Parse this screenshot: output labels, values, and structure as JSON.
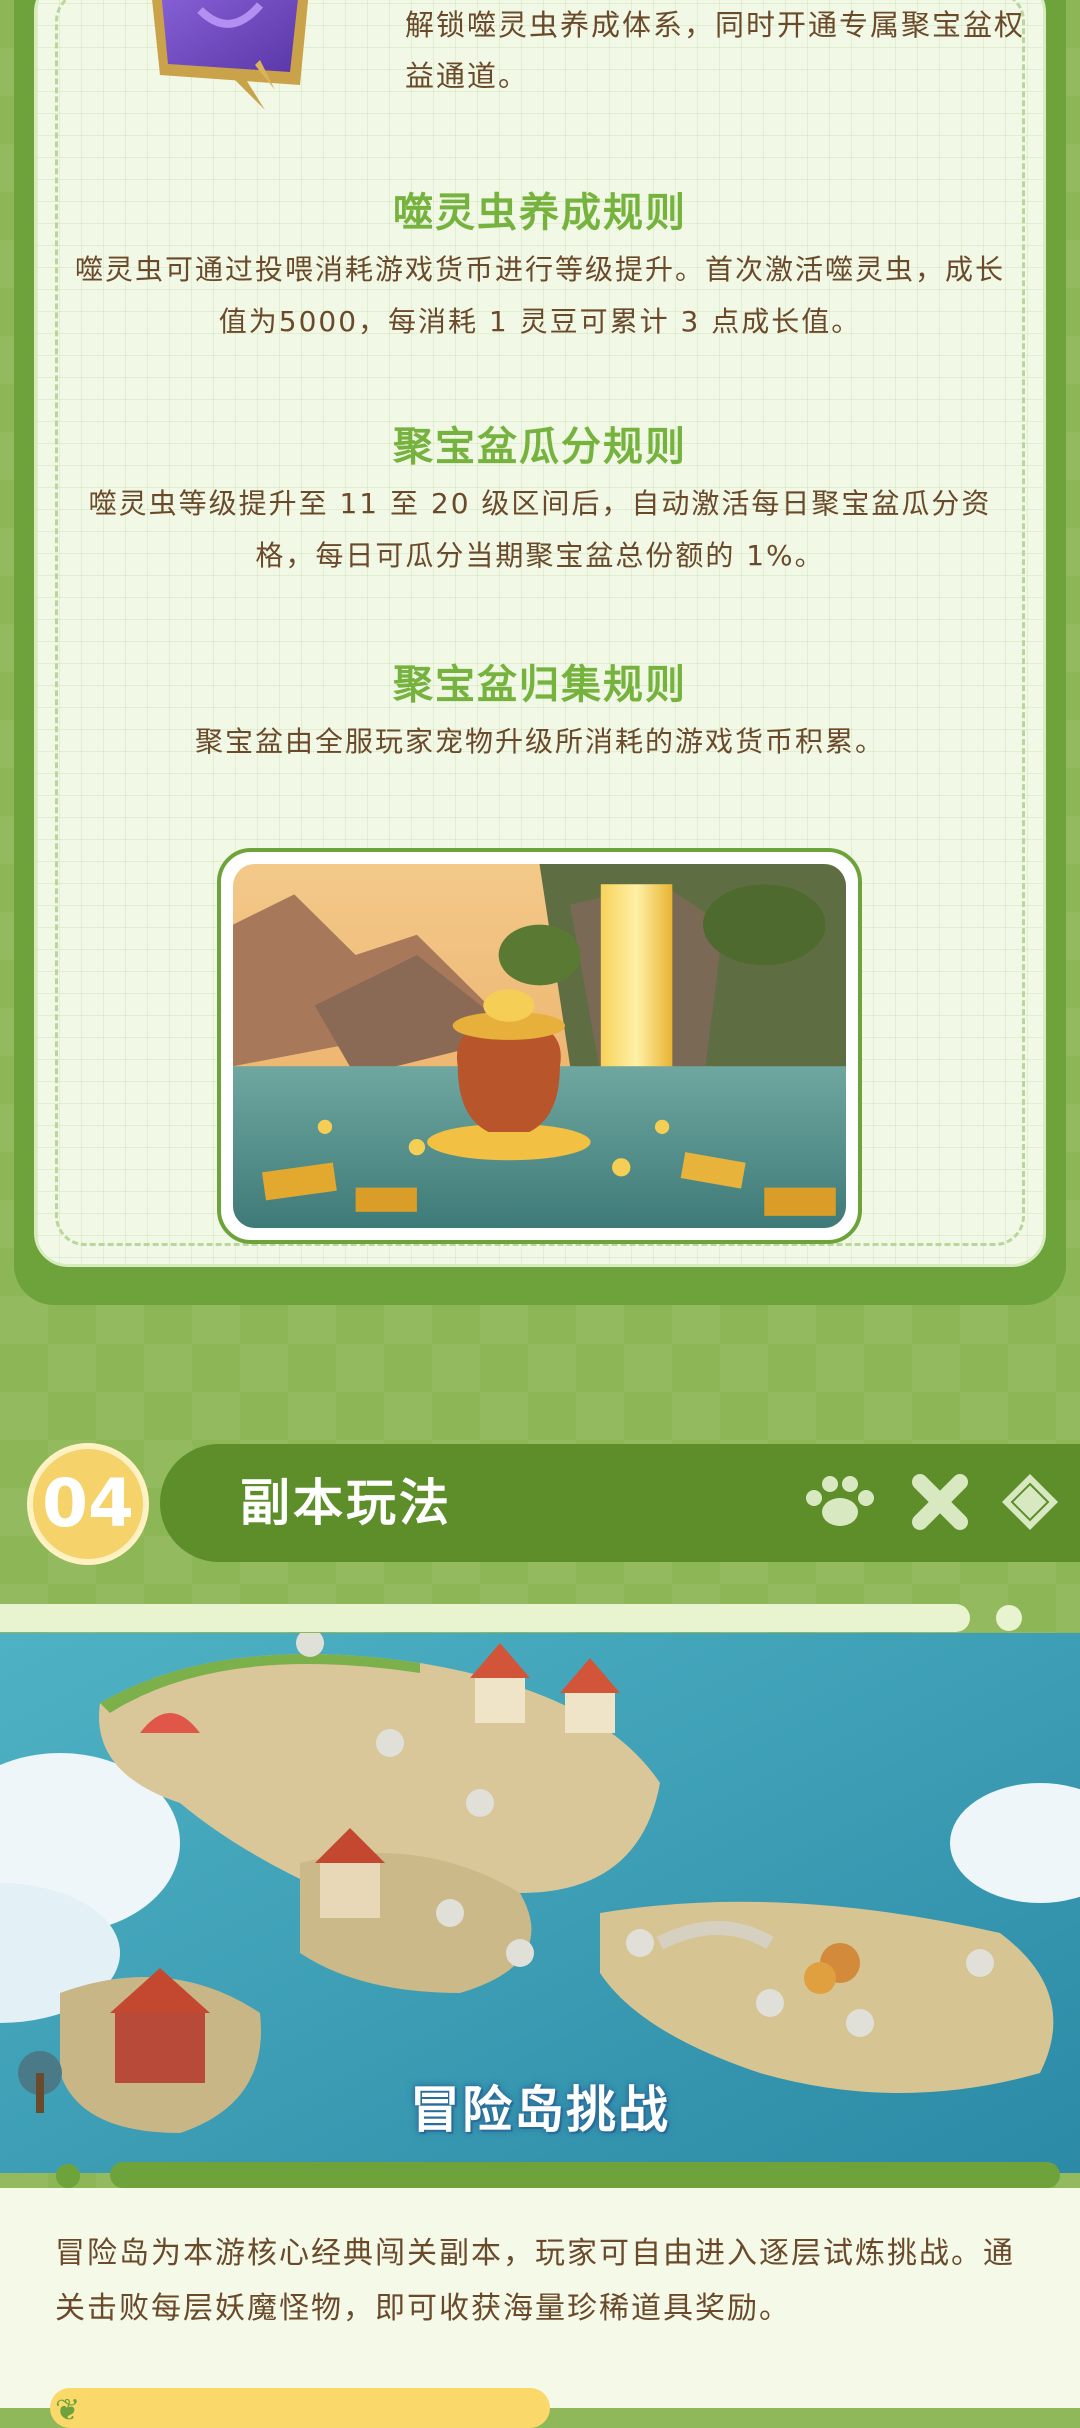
{
  "intro": {
    "text": "解锁噬灵虫养成体系，同时开通专属聚宝盆权益通道。"
  },
  "rules": [
    {
      "title": "噬灵虫养成规则",
      "text": "噬灵虫可通过投喂消耗游戏货币进行等级提升。首次激活噬灵虫，成长值为5000，每消耗 1 灵豆可累计 3 点成长值。"
    },
    {
      "title": "聚宝盆瓜分规则",
      "text": "噬灵虫等级提升至 11 至 20 级区间后，自动激活每日聚宝盆瓜分资格，每日可瓜分当期聚宝盆总份额的 1%。"
    },
    {
      "title": "聚宝盆归集规则",
      "text": "聚宝盆由全服玩家宠物升级所消耗的游戏货币积累。"
    }
  ],
  "section": {
    "number": "04",
    "title": "副本玩法",
    "icons": [
      "paw-icon",
      "cross-icon",
      "diamond-icon"
    ]
  },
  "map": {
    "title": "冒险岛挑战"
  },
  "description": "冒险岛为本游核心经典闯关副本，玩家可自由进入逐层试炼挑战。通关击败每层妖魔怪物，即可收获海量珍稀道具奖励。",
  "colors": {
    "accent": "#76b33e",
    "dark_green": "#5d8e2a",
    "text_brown": "#6a4a2a",
    "gold": "#f5d36a"
  }
}
